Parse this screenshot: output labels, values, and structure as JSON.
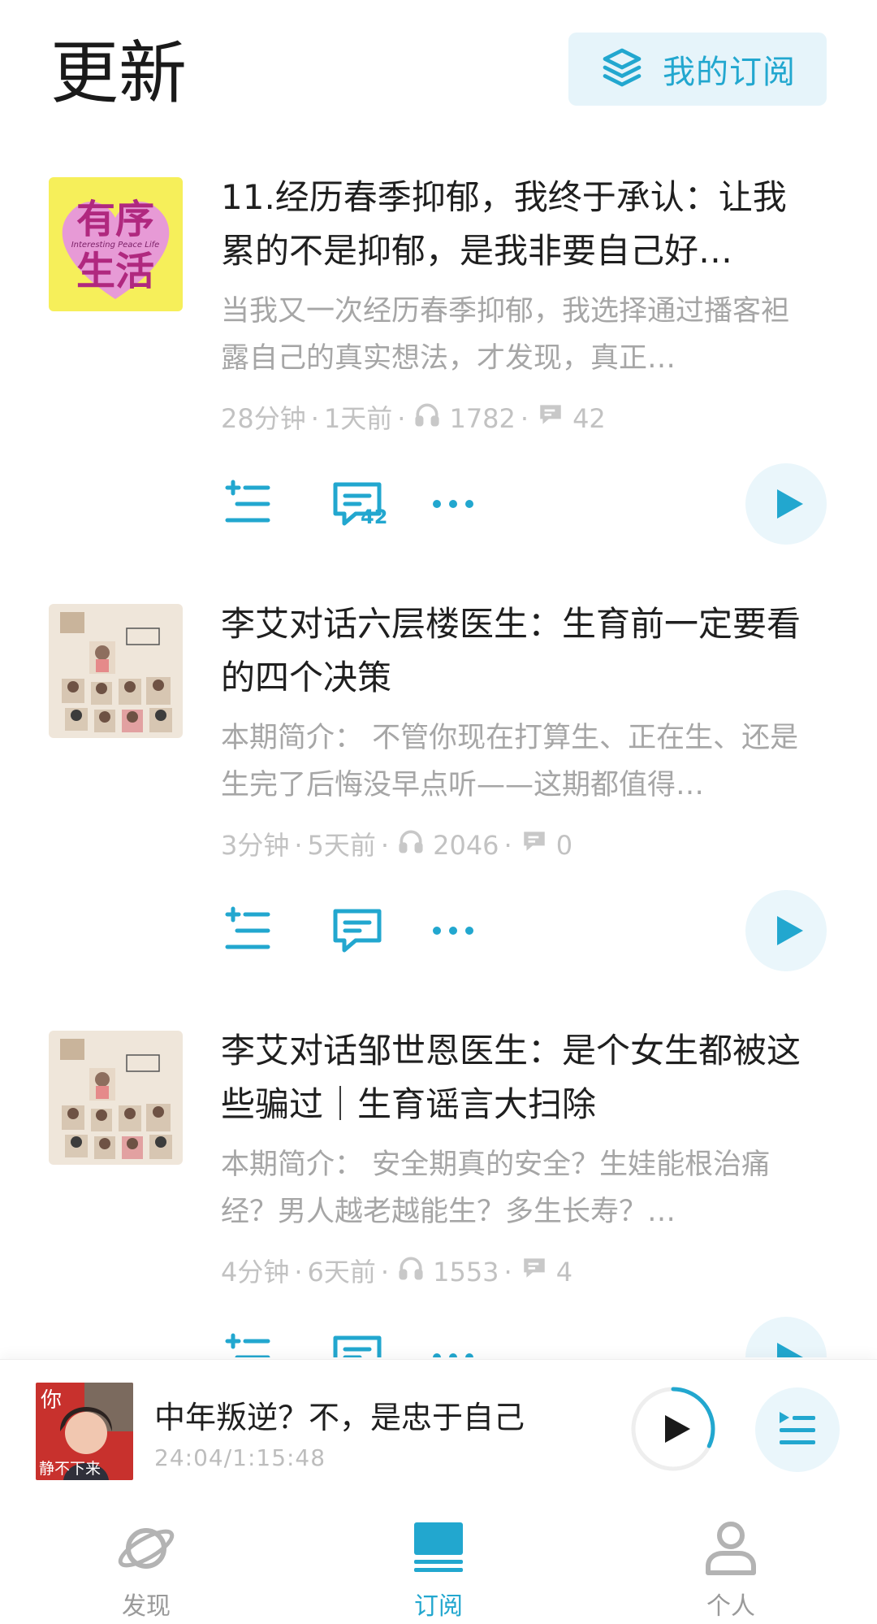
{
  "header": {
    "title": "更新",
    "subscriptions_button": "我的订阅"
  },
  "episodes": [
    {
      "title": "11.经历春季抑郁，我终于承认：让我累的不是抑郁，是我非要自己好…",
      "description": "当我又一次经历春季抑郁，我选择通过播客袒露自己的真实想法，才发现，真正…",
      "duration": "28分钟",
      "published": "1天前",
      "plays": "1782",
      "comments": "42",
      "comment_badge": "42",
      "cover": {
        "line1": "有序",
        "line2": "生活",
        "subtitle": "Interesting Peace Life"
      }
    },
    {
      "title": "李艾对话六层楼医生：生育前一定要看的四个决策",
      "description": "本期简介：  不管你现在打算生、正在生、还是生完了后悔没早点听——这期都值得…",
      "duration": "3分钟",
      "published": "5天前",
      "plays": "2046",
      "comments": "0",
      "comment_badge": ""
    },
    {
      "title": "李艾对话邹世恩医生：是个女生都被这些骗过｜生育谣言大扫除",
      "description": "本期简介：  安全期真的安全？生娃能根治痛经？男人越老越能生？多生长寿？…",
      "duration": "4分钟",
      "published": "6天前",
      "plays": "1553",
      "comments": "4",
      "comment_badge": ""
    }
  ],
  "meta_separator": "·",
  "mini_player": {
    "title": "中年叛逆？不，是忠于自己",
    "time": "24:04/1:15:48",
    "progress": 0.32,
    "cover_text_top": "你",
    "cover_text_bottom": "静不下来"
  },
  "nav": {
    "items": [
      {
        "label": "发现",
        "icon": "planet-icon",
        "active": false
      },
      {
        "label": "订阅",
        "icon": "subscriptions-icon",
        "active": true
      },
      {
        "label": "个人",
        "icon": "person-icon",
        "active": false
      }
    ]
  },
  "colors": {
    "accent": "#22a7cf",
    "accent_bg": "#e6f4fa",
    "meta_text": "#c2c2c2",
    "desc_text": "#a6a6a6"
  }
}
